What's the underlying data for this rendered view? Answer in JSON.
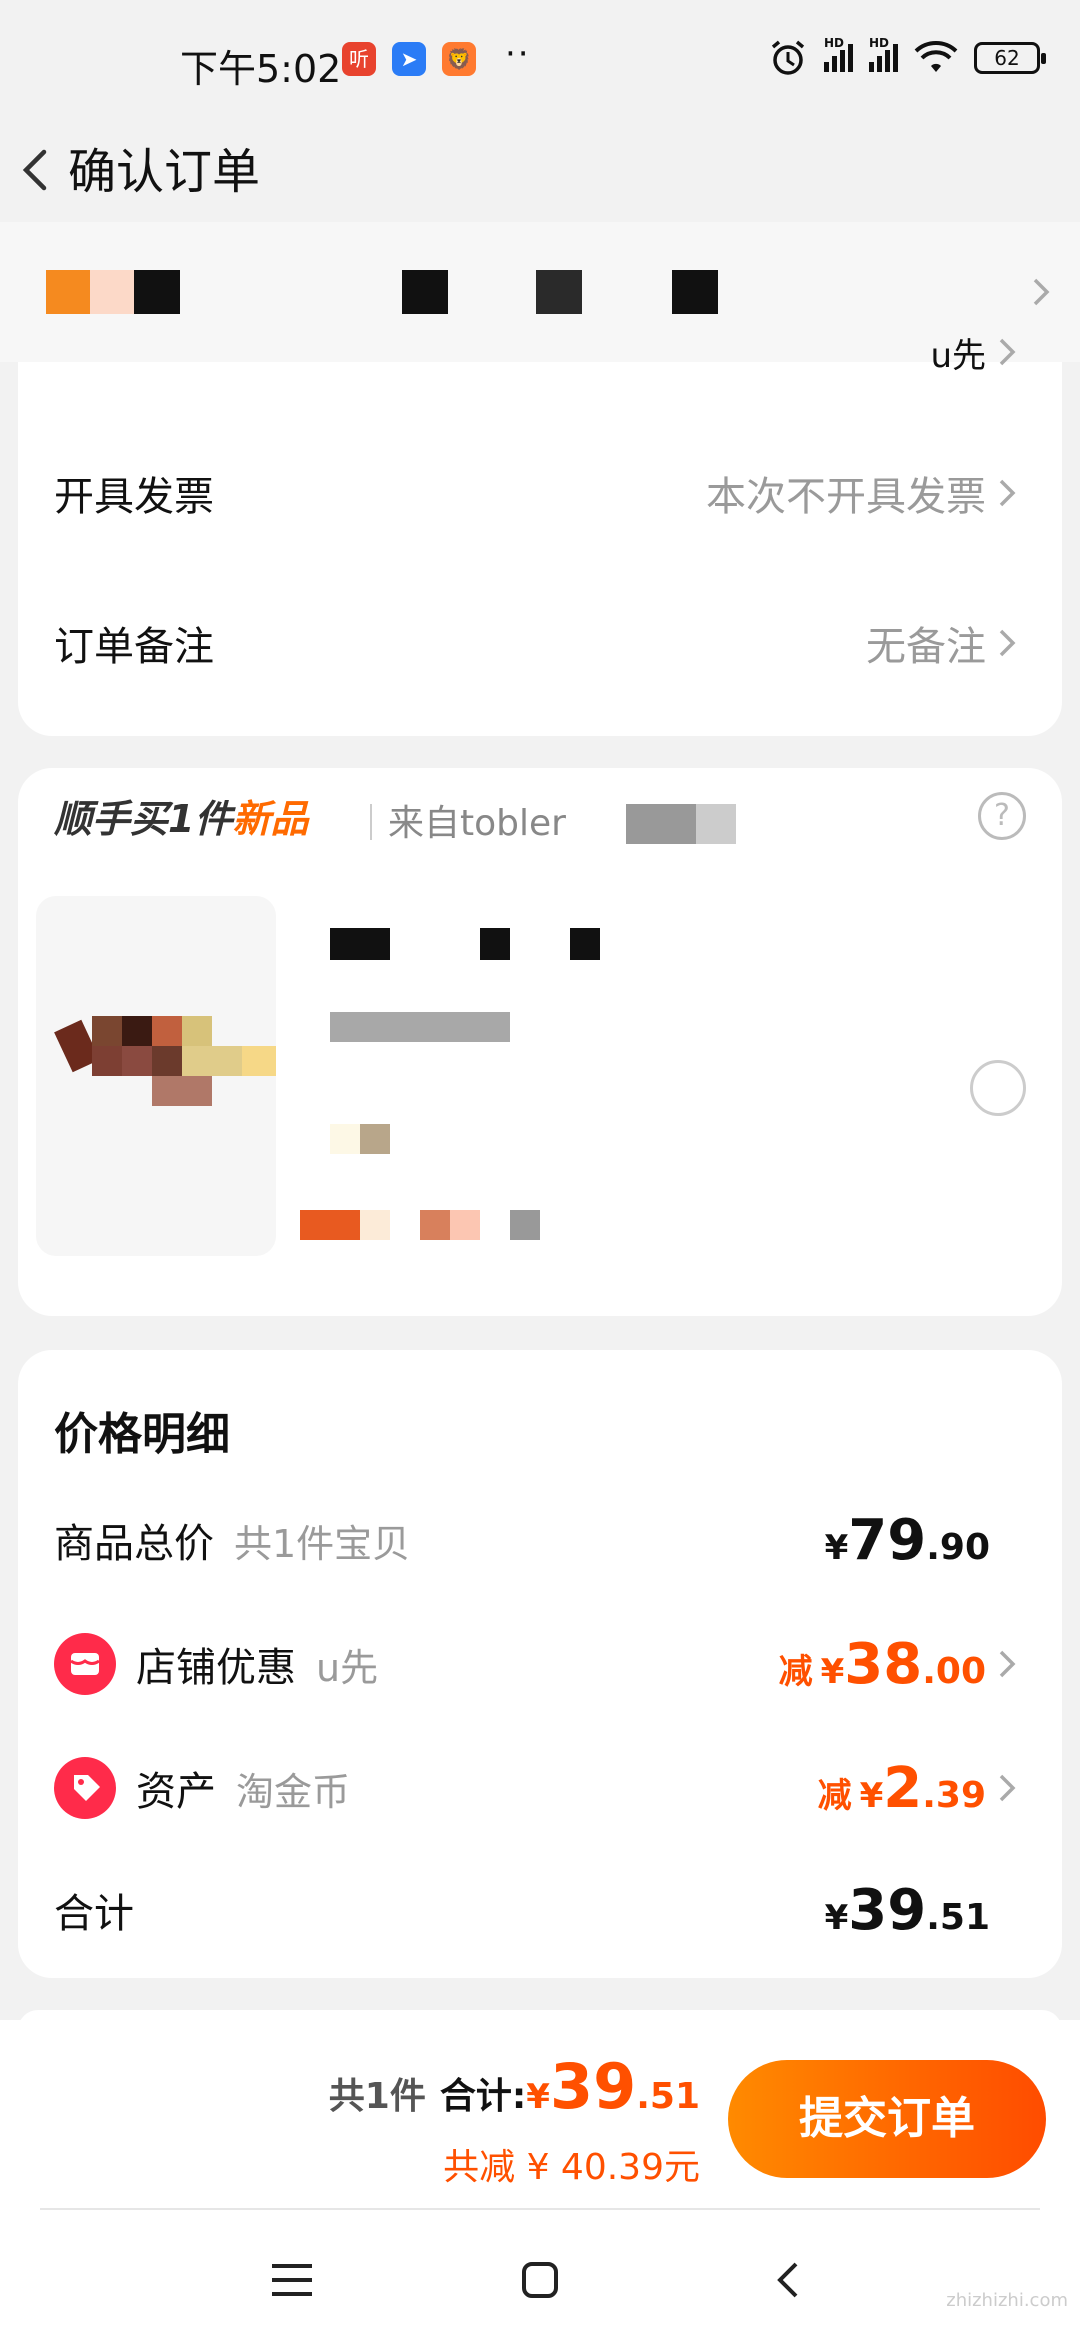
{
  "status": {
    "time": "下午5:02",
    "app_icons": [
      {
        "name": "ting-icon",
        "glyph": "听",
        "color": "#e8432e"
      },
      {
        "name": "feishu-icon",
        "glyph": "➤",
        "color": "#2b7cf6"
      },
      {
        "name": "lion-icon",
        "glyph": "🦁",
        "color": "#ff7a30"
      }
    ],
    "dots": "··",
    "battery": "62",
    "hd1": "HD",
    "hd2": "HD"
  },
  "header": {
    "title": "确认订单"
  },
  "address": {
    "partial_text": "u先"
  },
  "order_options": {
    "invoice": {
      "label": "开具发票",
      "value": "本次不开具发票"
    },
    "remark": {
      "label": "订单备注",
      "value": "无备注"
    }
  },
  "recommend": {
    "title_prefix": "顺手买1件",
    "title_new": "新品",
    "from": "来自tobler"
  },
  "price": {
    "title": "价格明细",
    "total": {
      "label": "商品总价",
      "sub": "共1件宝贝",
      "yen": "¥",
      "int": "79",
      "dec": ".90"
    },
    "shop": {
      "label": "店铺优惠",
      "sub": "u先",
      "minus": "减",
      "yen": "¥",
      "int": "38",
      "dec": ".00"
    },
    "asset": {
      "label": "资产",
      "sub": "淘金币",
      "minus": "减",
      "yen": "¥",
      "int": "2",
      "dec": ".39"
    },
    "sum": {
      "label": "合计",
      "yen": "¥",
      "int": "39",
      "dec": ".51"
    }
  },
  "bottom": {
    "count": "共1件",
    "sum_label": "合计:",
    "yen": "¥",
    "int": "39",
    "dec": ".51",
    "saved": "共减 ¥ 40.39元",
    "submit": "提交订单"
  },
  "watermark": "zhizhizhi.com",
  "colors": {
    "accent": "#ff5000",
    "button_start": "#ff8a00",
    "button_end": "#ff4c00",
    "coupon_red": "#ff2b4a"
  }
}
